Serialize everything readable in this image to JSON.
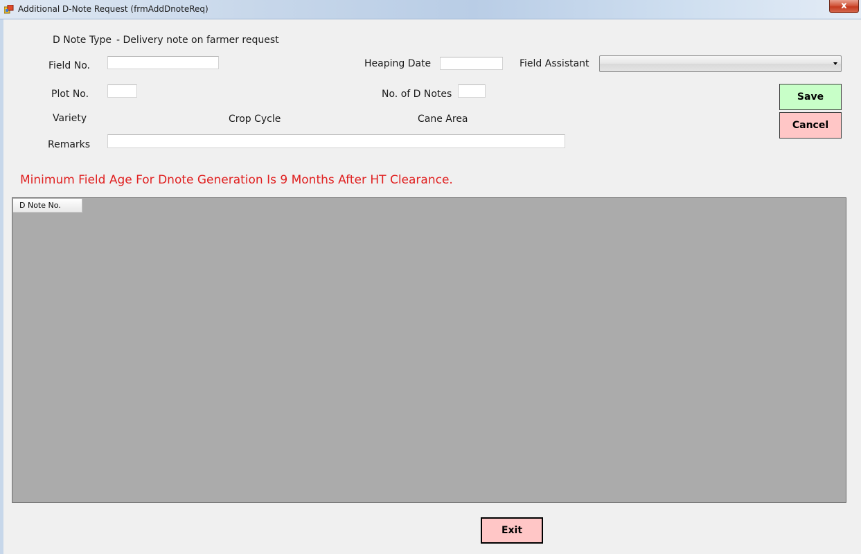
{
  "window": {
    "title": "Additional D-Note Request (frmAddDnoteReq)",
    "close_label": "x"
  },
  "form": {
    "dnote_type_label": "D Note Type",
    "dnote_type_value": " - Delivery note on farmer request",
    "field_no_label": "Field No.",
    "field_no_value": "",
    "heaping_date_label": "Heaping Date",
    "heaping_date_value": "",
    "field_assistant_label": "Field Assistant",
    "field_assistant_value": "",
    "plot_no_label": "Plot No.",
    "plot_no_value": "",
    "no_of_dnotes_label": "No. of D Notes",
    "no_of_dnotes_value": "",
    "variety_label": "Variety",
    "crop_cycle_label": "Crop Cycle",
    "cane_area_label": "Cane Area",
    "remarks_label": "Remarks",
    "remarks_value": ""
  },
  "buttons": {
    "save": "Save",
    "cancel": "Cancel",
    "exit": "Exit"
  },
  "warning": "Minimum Field Age For Dnote Generation Is 9 Months After HT Clearance.",
  "grid": {
    "columns": [
      "D Note No."
    ]
  },
  "colors": {
    "save_bg": "#c8ffc8",
    "cancel_bg": "#ffc6c6",
    "warning_text": "#e02020",
    "grid_bg": "#ababab"
  }
}
